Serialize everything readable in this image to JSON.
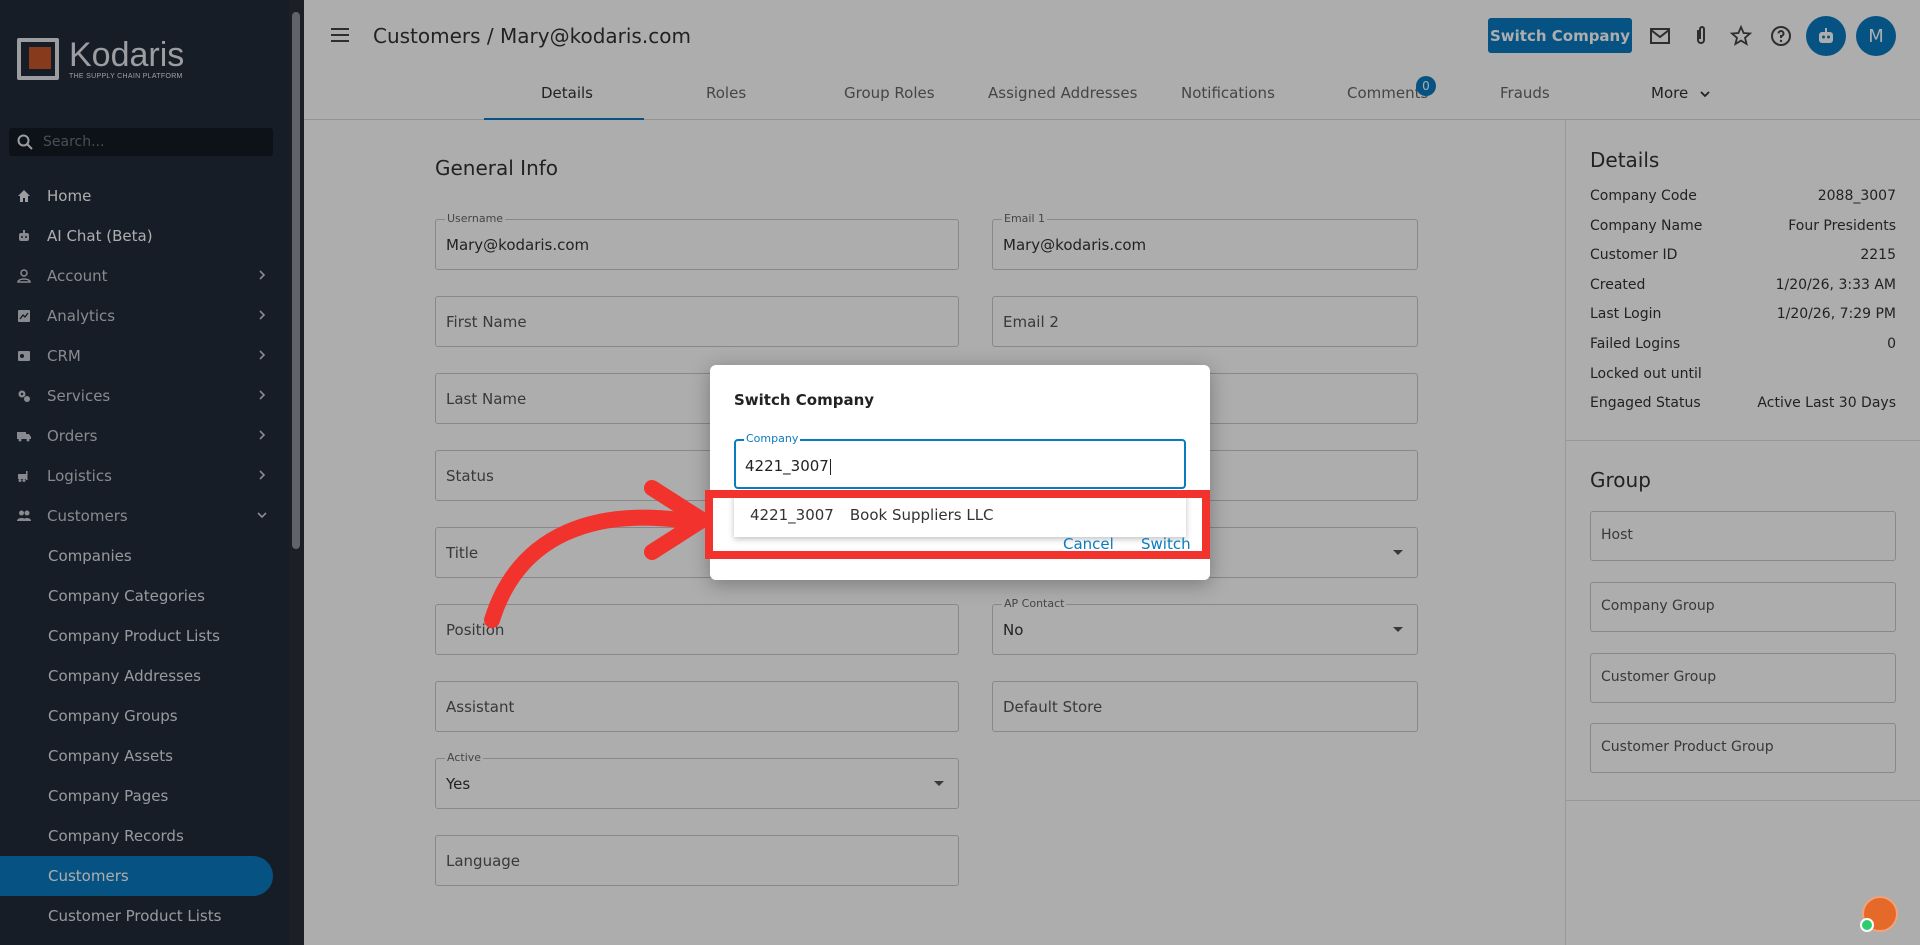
{
  "sidebar": {
    "brand": "Kodaris",
    "tagline": "THE SUPPLY CHAIN PLATFORM",
    "search_placeholder": "Search...",
    "items": [
      {
        "label": "Home"
      },
      {
        "label": "AI Chat (Beta)"
      },
      {
        "label": "Account"
      },
      {
        "label": "Analytics"
      },
      {
        "label": "CRM"
      },
      {
        "label": "Services"
      },
      {
        "label": "Orders"
      },
      {
        "label": "Logistics"
      },
      {
        "label": "Customers"
      }
    ],
    "sub_items": [
      {
        "label": "Companies"
      },
      {
        "label": "Company Categories"
      },
      {
        "label": "Company Product Lists"
      },
      {
        "label": "Company Addresses"
      },
      {
        "label": "Company Groups"
      },
      {
        "label": "Company Assets"
      },
      {
        "label": "Company Pages"
      },
      {
        "label": "Company Records"
      },
      {
        "label": "Customers"
      },
      {
        "label": "Customer Product Lists"
      }
    ]
  },
  "header": {
    "breadcrumb": "Customers / Mary@kodaris.com",
    "switch_company": "Switch Company",
    "avatar_initial": "M"
  },
  "tabs": [
    {
      "label": "Details"
    },
    {
      "label": "Roles"
    },
    {
      "label": "Group Roles"
    },
    {
      "label": "Assigned Addresses"
    },
    {
      "label": "Notifications"
    },
    {
      "label": "Comments"
    },
    {
      "label": "Frauds"
    },
    {
      "label": "More"
    }
  ],
  "comments_badge": "0",
  "form": {
    "title": "General Info",
    "username_label": "Username",
    "username_value": "Mary@kodaris.com",
    "email1_label": "Email 1",
    "email1_value": "Mary@kodaris.com",
    "first_name": "First Name",
    "email2": "Email 2",
    "last_name": "Last Name",
    "status": "Status",
    "title_field": "Title",
    "position": "Position",
    "ap_contact_label": "AP Contact",
    "ap_contact_value": "No",
    "assistant": "Assistant",
    "default_store": "Default Store",
    "active_label": "Active",
    "active_value": "Yes",
    "language": "Language"
  },
  "details": {
    "title": "Details",
    "rows": [
      {
        "k": "Company Code",
        "v": "2088_3007"
      },
      {
        "k": "Company Name",
        "v": "Four Presidents"
      },
      {
        "k": "Customer ID",
        "v": "2215"
      },
      {
        "k": "Created",
        "v": "1/20/26, 3:33 AM"
      },
      {
        "k": "Last Login",
        "v": "1/20/26, 7:29 PM"
      },
      {
        "k": "Failed Logins",
        "v": "0"
      },
      {
        "k": "Locked out until",
        "v": ""
      },
      {
        "k": "Engaged Status",
        "v": "Active Last 30 Days"
      }
    ]
  },
  "group": {
    "title": "Group",
    "fields": [
      {
        "label": "Host"
      },
      {
        "label": "Company Group"
      },
      {
        "label": "Customer Group"
      },
      {
        "label": "Customer Product Group"
      }
    ]
  },
  "dialog": {
    "title": "Switch Company",
    "input_label": "Company",
    "input_value": "4221_3007",
    "suggestion_code": "4221_3007",
    "suggestion_name": "Book Suppliers LLC",
    "cancel": "Cancel",
    "switch": "Switch"
  },
  "colors": {
    "accent": "#0a7bc1",
    "sidebar_bg": "#222b3a",
    "highlight": "#f2322c"
  }
}
